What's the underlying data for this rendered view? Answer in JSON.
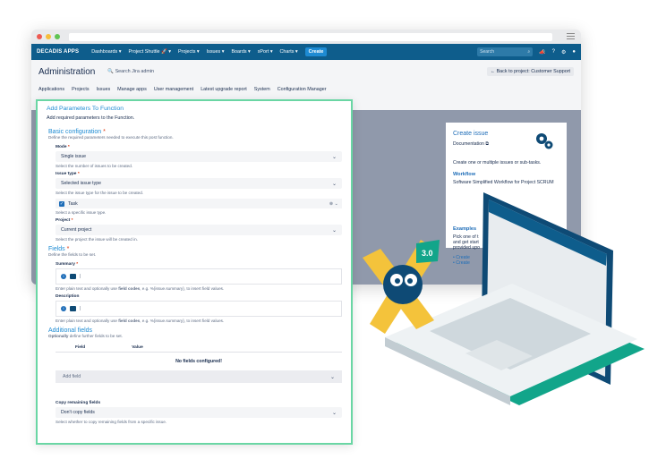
{
  "nav": {
    "logo": "DECADIS APPS",
    "items": [
      "Dashboards ▾",
      "Project Shuttle 🚀 ▾",
      "Projects ▾",
      "Issues ▾",
      "Boards ▾",
      "xPort ▾",
      "Charts ▾"
    ],
    "create": "Create",
    "search_placeholder": "Search"
  },
  "admin": {
    "title": "Administration",
    "search": "🔍 Search Jira admin",
    "back": "← Back to project: Customer Support",
    "tabs": [
      "Applications",
      "Projects",
      "Issues",
      "Manage apps",
      "User management",
      "Latest upgrade report",
      "System",
      "Configuration Manager"
    ]
  },
  "side_card": {
    "title": "Create issue",
    "doc": "Documentation ⧉",
    "desc": "Create one or multiple issues or sub-tasks.",
    "workflow_head": "Workflow",
    "workflow": "Software Simplified Workflow for Project SCRUM",
    "examples_head": "Examples",
    "pick": "Pick one of t",
    "start": "and get start",
    "provided": "provided upo",
    "bullet1": "Create",
    "bullet2": "Create"
  },
  "dialog": {
    "title": "Add Parameters To Function",
    "desc": "Add required parameters to the Function.",
    "basic": {
      "head": "Basic configuration",
      "desc": "Define the required parameters needed to execute this post function.",
      "mode_label": "Mode",
      "mode_value": "Single issue",
      "mode_help": "Select the number of issues to be created.",
      "type_label": "Issue type",
      "type_value": "Selected issue type",
      "type_help": "Select the issue type for the issue to be created.",
      "task": "Task",
      "task_help": "Select a specific issue type.",
      "project_label": "Project",
      "project_value": "Current project",
      "project_help": "Select the project the issue will be created in."
    },
    "fields": {
      "head": "Fields",
      "desc": "Define the fields to be set.",
      "summary_label": "Summary",
      "summary_help_pre": "Enter plain text and optionally use ",
      "summary_help_bold": "field codes",
      "summary_help_post": ", e.g. %{issue.summary}, to insert field values.",
      "description_label": "Description",
      "desc_help_pre": "Enter plain text and optionally use ",
      "desc_help_bold": "field codes",
      "desc_help_post": ", e.g. %{issue.summary}, to insert field values."
    },
    "additional": {
      "head": "Additional fields",
      "desc_bold": "Optionally",
      "desc_rest": " define further fields to be set.",
      "col_field": "Field",
      "col_value": "Value",
      "empty": "No fields configured!",
      "add": "Add field"
    },
    "copy": {
      "label": "Copy remaining fields",
      "value": "Don't copy fields",
      "help": "Select whether to copy remaining fields from a specific issue."
    }
  },
  "mascot_badge": "3.0"
}
